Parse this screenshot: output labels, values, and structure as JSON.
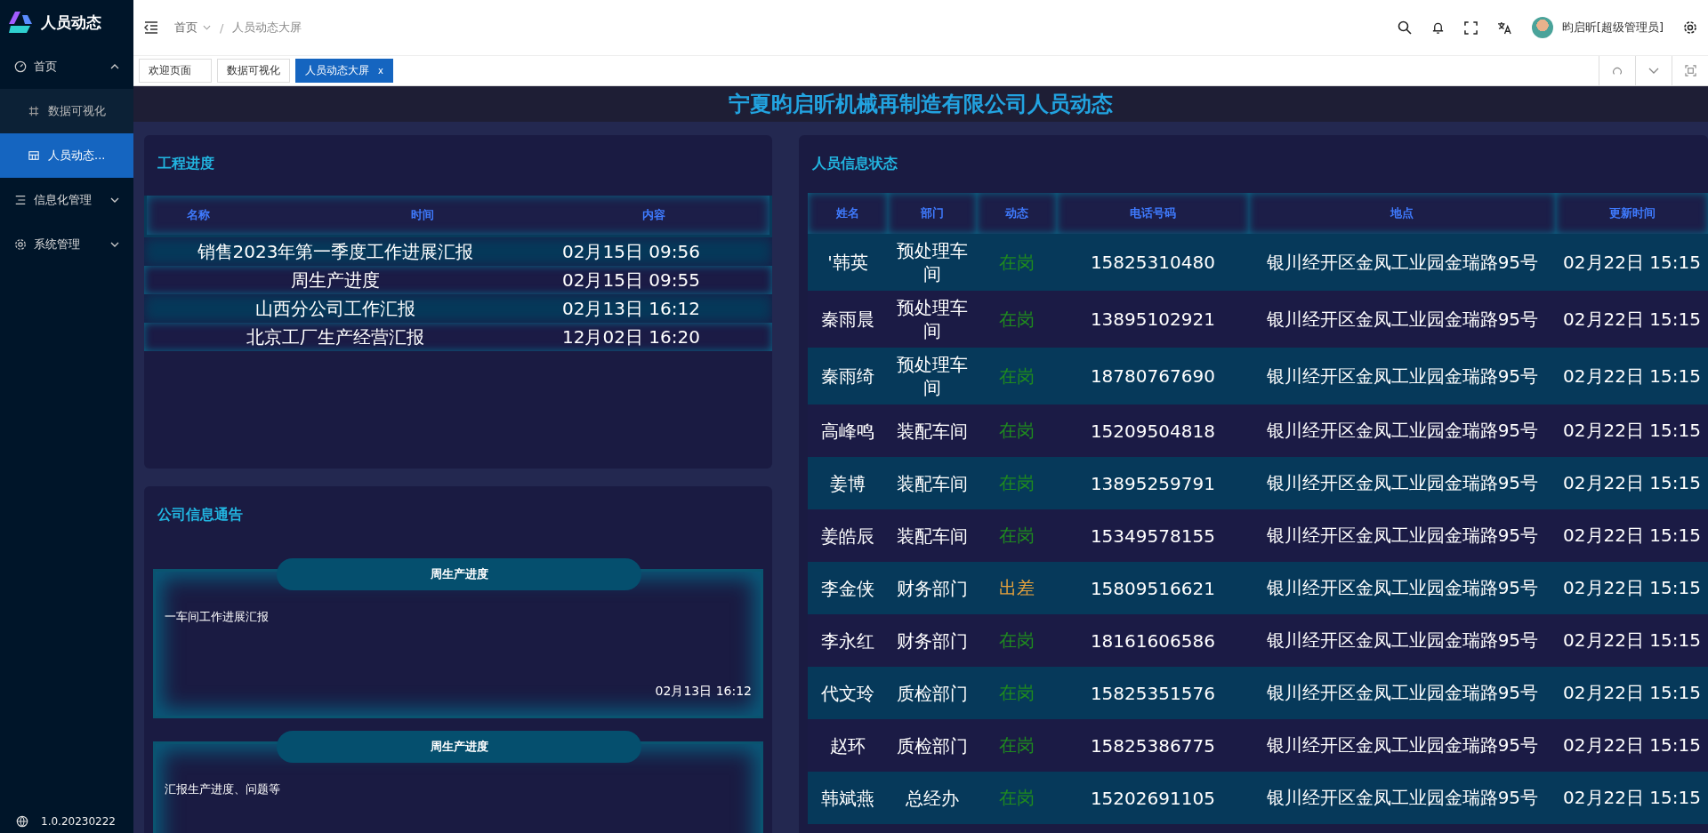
{
  "sidebar": {
    "app_title": "人员动态",
    "items": [
      {
        "label": "首页",
        "expanded": true,
        "selected": false,
        "children": [
          {
            "label": "数据可视化",
            "selected": false
          },
          {
            "label": "人员动态...",
            "selected": true
          }
        ]
      },
      {
        "label": "信息化管理",
        "expanded": false,
        "selected": false
      },
      {
        "label": "系统管理",
        "expanded": false,
        "selected": false
      }
    ],
    "version": "1.0.20230222"
  },
  "header": {
    "breadcrumb": [
      {
        "label": "首页",
        "dropdown": true
      },
      {
        "label": "人员动态大屏",
        "dropdown": false
      }
    ],
    "separator": "/",
    "user": "昀启昕[超级管理员]"
  },
  "tabs": [
    {
      "label": "欢迎页面",
      "selected": false
    },
    {
      "label": "数据可视化",
      "selected": false
    },
    {
      "label": "人员动态大屏",
      "selected": true,
      "close": "x"
    }
  ],
  "page_title": "宁夏昀启昕机械再制造有限公司人员动态",
  "progress": {
    "title": "工程进度",
    "columns": [
      "名称",
      "时间",
      "内容"
    ],
    "rows": [
      {
        "name": "销售2023年第一季度工作进展汇报",
        "time": "02月15日 09:56"
      },
      {
        "name": "周生产进度",
        "time": "02月15日 09:55"
      },
      {
        "name": "山西分公司工作汇报",
        "time": "02月13日 16:12"
      },
      {
        "name": "北京工厂生产经营汇报",
        "time": "12月02日 16:20"
      }
    ]
  },
  "notices": {
    "title": "公司信息通告",
    "items": [
      {
        "title": "周生产进度",
        "content": "一车间工作进展汇报",
        "time": "02月13日 16:12"
      },
      {
        "title": "周生产进度",
        "content": "汇报生产进度、问题等"
      }
    ]
  },
  "staff": {
    "title": "人员信息状态",
    "columns": [
      "姓名",
      "部门",
      "动态",
      "电话号码",
      "地点",
      "更新时间"
    ],
    "rows": [
      {
        "name": "'韩英",
        "dept": "预处理车间",
        "status": {
          "text": "在岗",
          "color": "#1f8a1f"
        },
        "phone": "15825310480",
        "place": "银川经开区金凤工业园金瑞路95号",
        "time": "02月22日 15:15"
      },
      {
        "name": "秦雨晨",
        "dept": "预处理车间",
        "status": {
          "text": "在岗",
          "color": "#1f8a1f"
        },
        "phone": "13895102921",
        "place": "银川经开区金凤工业园金瑞路95号",
        "time": "02月22日 15:15"
      },
      {
        "name": "秦雨绮",
        "dept": "预处理车间",
        "status": {
          "text": "在岗",
          "color": "#1f8a1f"
        },
        "phone": "18780767690",
        "place": "银川经开区金凤工业园金瑞路95号",
        "time": "02月22日 15:15"
      },
      {
        "name": "高峰鸣",
        "dept": "装配车间",
        "status": {
          "text": "在岗",
          "color": "#1f8a1f"
        },
        "phone": "15209504818",
        "place": "银川经开区金凤工业园金瑞路95号",
        "time": "02月22日 15:15"
      },
      {
        "name": "姜博",
        "dept": "装配车间",
        "status": {
          "text": "在岗",
          "color": "#1f8a1f"
        },
        "phone": "13895259791",
        "place": "银川经开区金凤工业园金瑞路95号",
        "time": "02月22日 15:15"
      },
      {
        "name": "姜皓辰",
        "dept": "装配车间",
        "status": {
          "text": "在岗",
          "color": "#1f8a1f"
        },
        "phone": "15349578155",
        "place": "银川经开区金凤工业园金瑞路95号",
        "time": "02月22日 15:15"
      },
      {
        "name": "李金侠",
        "dept": "财务部门",
        "status": {
          "text": "出差",
          "color": "#e6a23c"
        },
        "phone": "15809516621",
        "place": "银川经开区金凤工业园金瑞路95号",
        "time": "02月22日 15:15"
      },
      {
        "name": "李永红",
        "dept": "财务部门",
        "status": {
          "text": "在岗",
          "color": "#1f8a1f"
        },
        "phone": "18161606586",
        "place": "银川经开区金凤工业园金瑞路95号",
        "time": "02月22日 15:15"
      },
      {
        "name": "代文玲",
        "dept": "质检部门",
        "status": {
          "text": "在岗",
          "color": "#1f8a1f"
        },
        "phone": "15825351576",
        "place": "银川经开区金凤工业园金瑞路95号",
        "time": "02月22日 15:15"
      },
      {
        "name": "赵环",
        "dept": "质检部门",
        "status": {
          "text": "在岗",
          "color": "#1f8a1f"
        },
        "phone": "15825386775",
        "place": "银川经开区金凤工业园金瑞路95号",
        "time": "02月22日 15:15"
      },
      {
        "name": "韩斌燕",
        "dept": "总经办",
        "status": {
          "text": "在岗",
          "color": "#1f8a1f"
        },
        "phone": "15202691105",
        "place": "银川经开区金凤工业园金瑞路95号",
        "time": "02月22日 15:15"
      }
    ]
  }
}
